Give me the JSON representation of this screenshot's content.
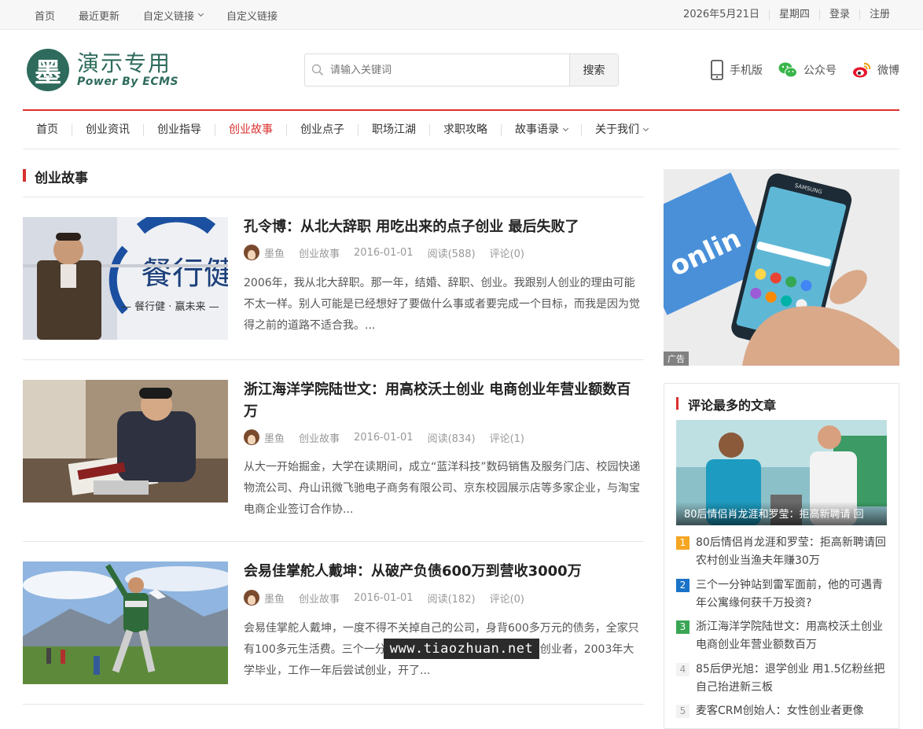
{
  "topbar": {
    "links": [
      "首页",
      "最近更新",
      "自定义链接",
      "自定义链接"
    ],
    "date": "2026年5月21日",
    "weekday": "星期四",
    "login": "登录",
    "register": "注册"
  },
  "logo": {
    "mark": "墨",
    "title": "演示专用",
    "subtitle": "Power By ECMS"
  },
  "search": {
    "placeholder": "请输入关键词",
    "button": "搜索"
  },
  "header_links": [
    "手机版",
    "公众号",
    "微博"
  ],
  "nav": [
    "首页",
    "创业资讯",
    "创业指导",
    "创业故事",
    "创业点子",
    "职场江湖",
    "求职攻略",
    "故事语录",
    "关于我们"
  ],
  "section_title": "创业故事",
  "posts": [
    {
      "title": "孔令博：从北大辞职 用吃出来的点子创业 最后失败了",
      "author": "墨鱼",
      "category": "创业故事",
      "date": "2016-01-01",
      "reads": "阅读(588)",
      "comments": "评论(0)",
      "excerpt": "2006年，我从北大辞职。那一年，结婚、辞职、创业。我跟别人创业的理由可能不太一样。别人可能是已经想好了要做什么事或者要完成一个目标，而我是因为觉得之前的道路不适合我。..."
    },
    {
      "title": "浙江海洋学院陆世文：用高校沃土创业 电商创业年营业额数百万",
      "author": "墨鱼",
      "category": "创业故事",
      "date": "2016-01-01",
      "reads": "阅读(834)",
      "comments": "评论(1)",
      "excerpt": "从大一开始掘金，大学在读期间，成立“蓝洋科技”数码销售及服务门店、校园快递物流公司、舟山讯微飞驰电子商务有限公司、京东校园展示店等多家企业，与淘宝电商企业签订合作协..."
    },
    {
      "title": "会易佳掌舵人戴坤：从破产负债600万到营收3000万",
      "author": "墨鱼",
      "category": "创业故事",
      "date": "2016-01-01",
      "reads": "阅读(182)",
      "comments": "评论(0)",
      "excerpt": "会易佳掌舵人戴坤，一度不得不关掉自己的公司，身背600多万元的债务，全家只有100多元生活费。三个一分钟站到雷军面前，他是一个连续创业者，2003年大学毕业，工作一年后尝试创业，开了..."
    }
  ],
  "ad": {
    "tag": "广告",
    "phone_brand": "SAMSUNG",
    "sign_text": "onlin"
  },
  "widget": {
    "title": "评论最多的文章",
    "featured_caption": "80后情侣肖龙涯和罗莹：拒高新聘请 回",
    "items": [
      {
        "num": "1",
        "color": "#f5a623",
        "text": "80后情侣肖龙涯和罗莹：拒高新聘请回农村创业当渔夫年赚30万"
      },
      {
        "num": "2",
        "color": "#1a73c8",
        "text": "三个一分钟站到雷军面前，他的可遇青年公寓缘何获千万投资?"
      },
      {
        "num": "3",
        "color": "#3aa655",
        "text": "浙江海洋学院陆世文：用高校沃土创业 电商创业年营业额数百万"
      },
      {
        "num": "4",
        "color": "#cccccc",
        "text": "85后伊光旭：退学创业 用1.5亿粉丝把自己抬进新三板"
      },
      {
        "num": "5",
        "color": "#cccccc",
        "text": "麦客CRM创始人：女性创业者更像"
      }
    ]
  },
  "watermark": "www.tiaozhuan.net"
}
